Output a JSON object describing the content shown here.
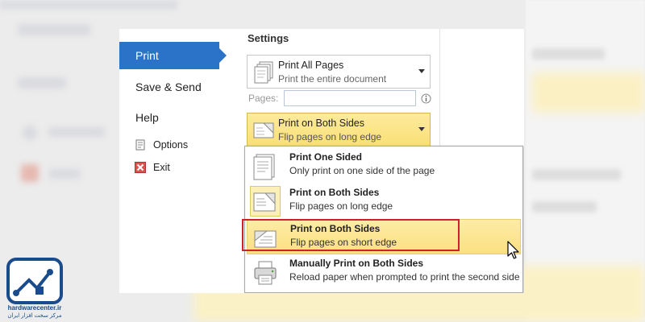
{
  "nav": {
    "print": "Print",
    "save_send": "Save & Send",
    "help": "Help",
    "options": "Options",
    "exit": "Exit"
  },
  "settings": {
    "title": "Settings",
    "print_pages": {
      "title": "Print All Pages",
      "subtitle": "Print the entire document"
    },
    "pages_label": "Pages:",
    "pages_value": "",
    "sides_selected": {
      "title": "Print on Both Sides",
      "subtitle": "Flip pages on long edge"
    }
  },
  "dropdown": {
    "options": [
      {
        "title": "Print One Sided",
        "subtitle": "Only print on one side of the page"
      },
      {
        "title": "Print on Both Sides",
        "subtitle": "Flip pages on long edge"
      },
      {
        "title": "Print on Both Sides",
        "subtitle": "Flip pages on short edge"
      },
      {
        "title": "Manually Print on Both Sides",
        "subtitle": "Reload paper when prompted to print the second side"
      }
    ]
  },
  "watermark": {
    "site": "hardwarecenter.ir",
    "tagline": "مرکز سخت افزار ایران"
  },
  "colors": {
    "accent_blue": "#2a73c8",
    "highlight_yellow": "#fadf76",
    "annotation_red": "#d0202a"
  }
}
